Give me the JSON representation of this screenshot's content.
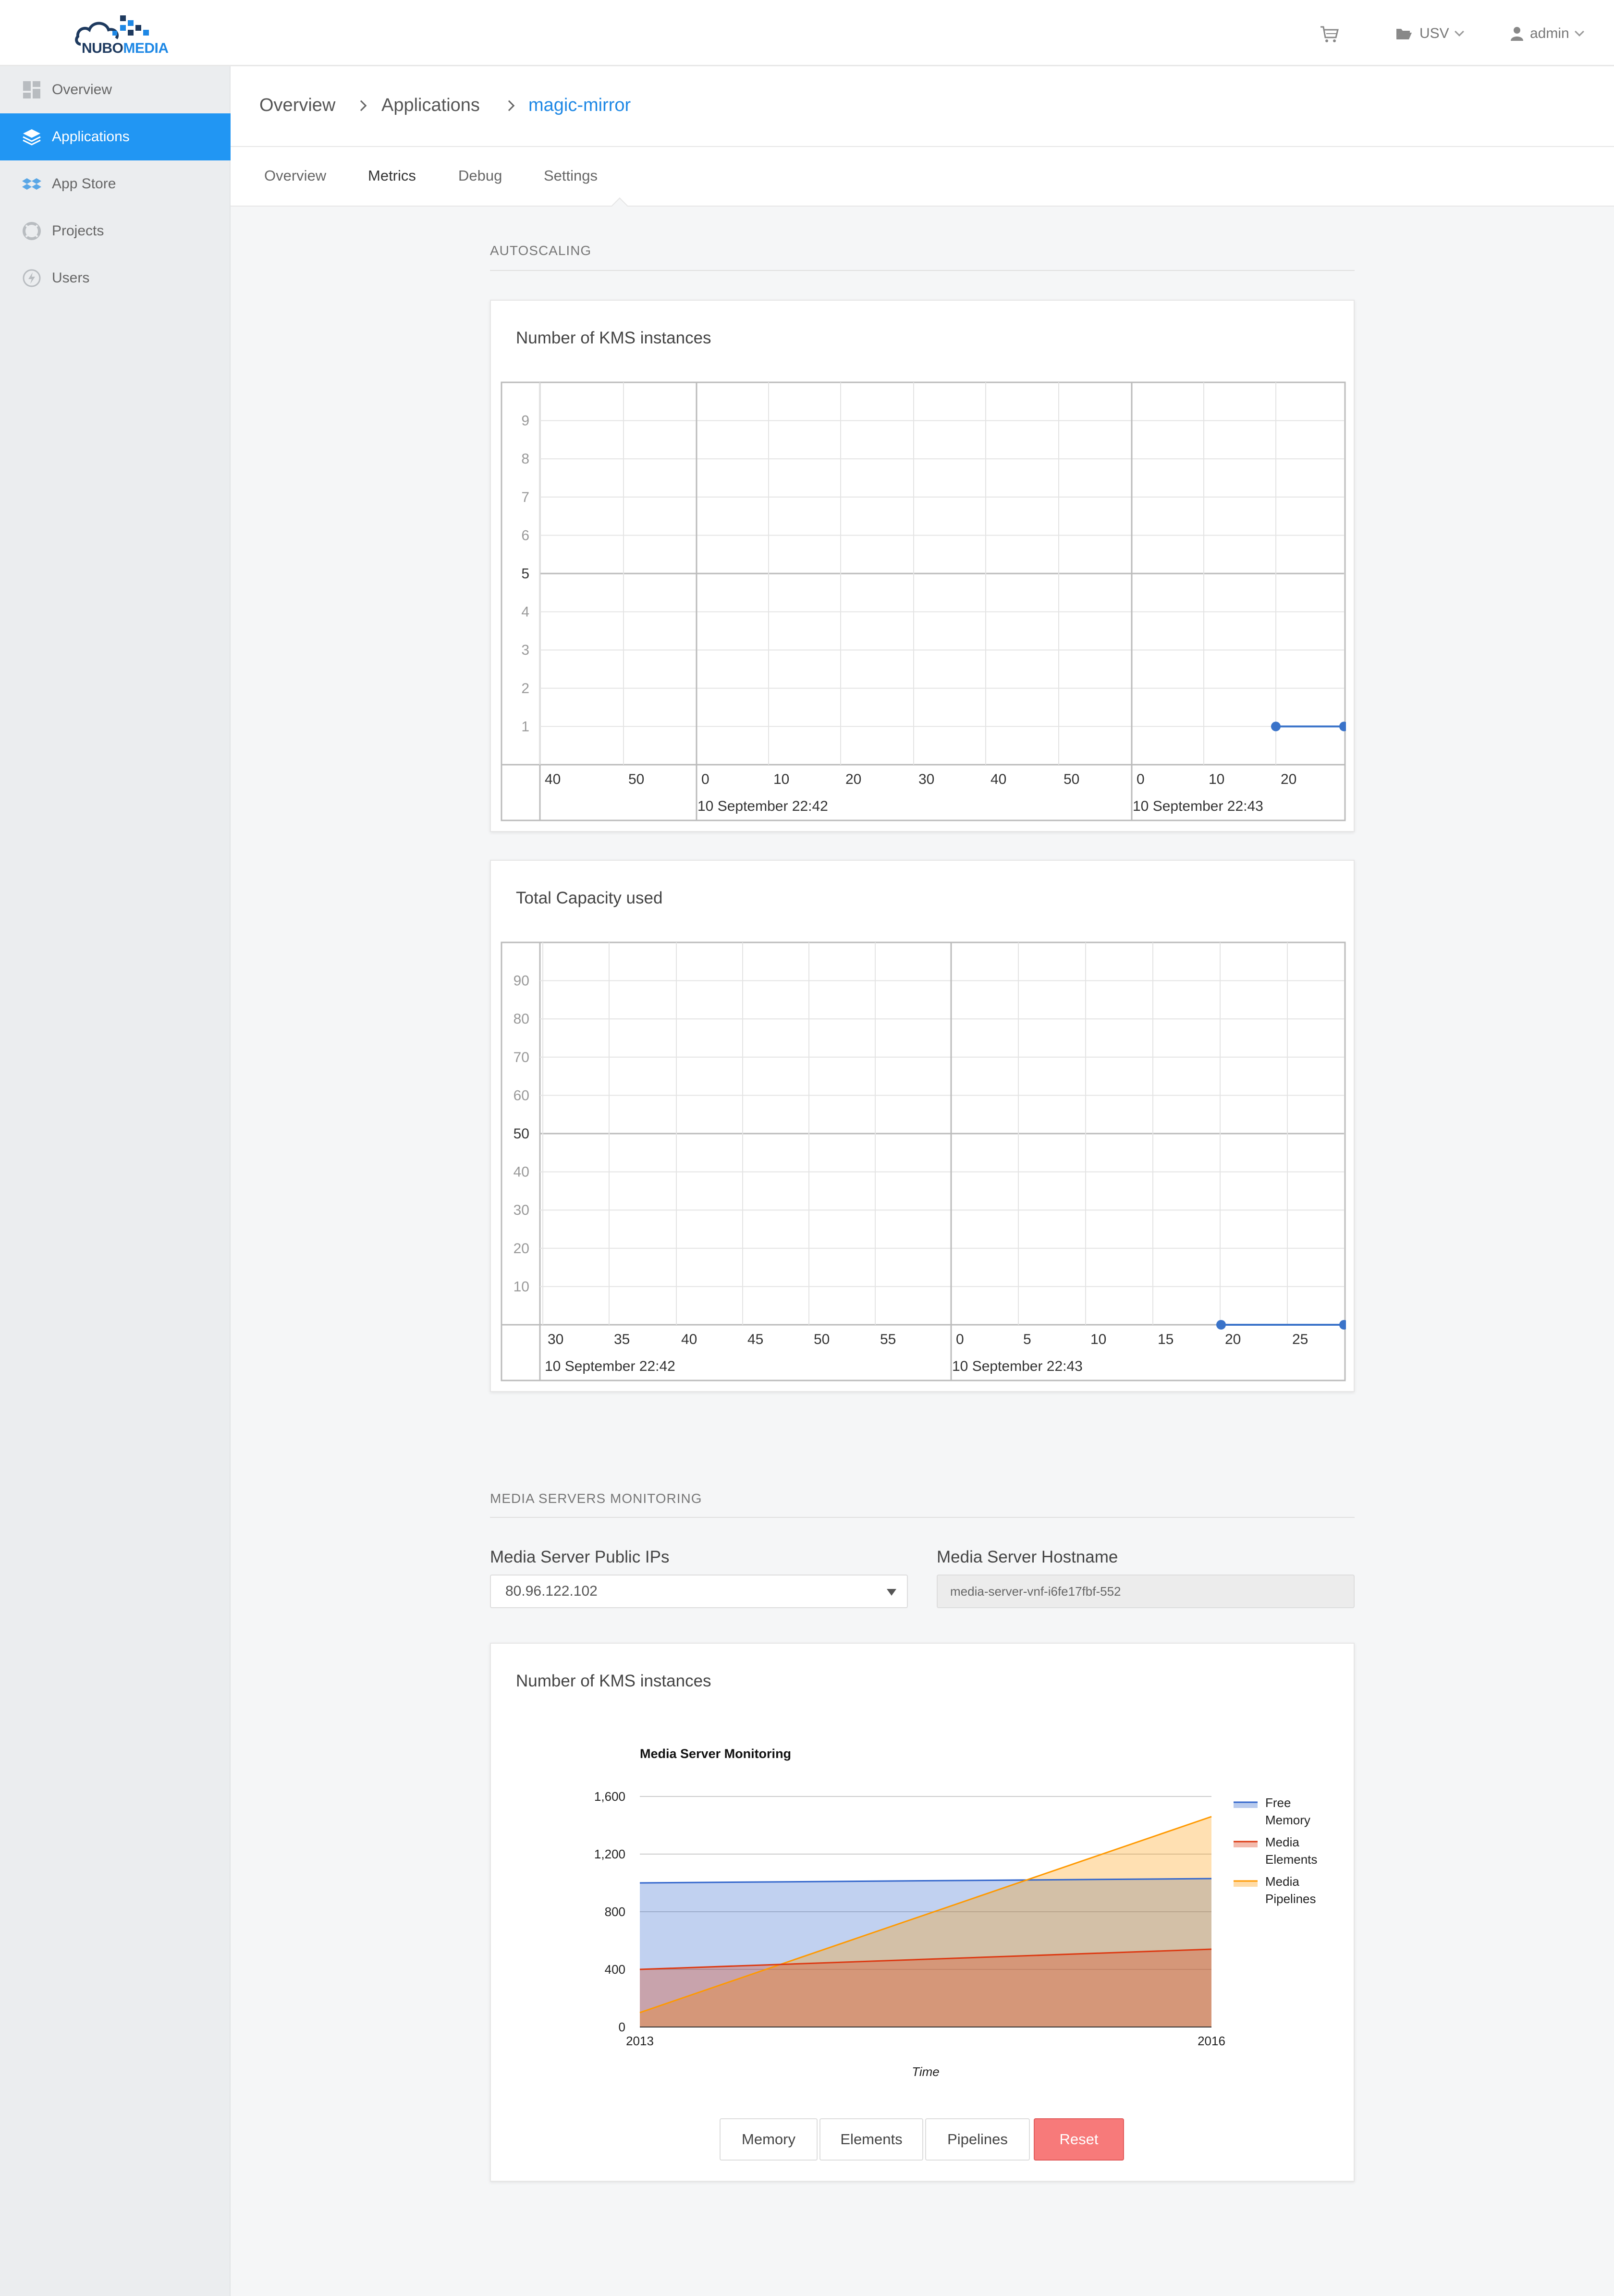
{
  "header": {
    "logo_text_a": "NUBO",
    "logo_text_b": "MEDIA",
    "project_label": "USV",
    "user_label": "admin"
  },
  "sidebar": {
    "items": [
      {
        "label": "Overview",
        "icon": "dashboard-icon"
      },
      {
        "label": "Applications",
        "icon": "layers-icon"
      },
      {
        "label": "App Store",
        "icon": "dropbox-icon"
      },
      {
        "label": "Projects",
        "icon": "lifebuoy-icon"
      },
      {
        "label": "Users",
        "icon": "bolt-icon"
      }
    ],
    "active_index": 1
  },
  "breadcrumb": {
    "items": [
      "Overview",
      "Applications",
      "magic-mirror"
    ]
  },
  "tabs": {
    "items": [
      "Overview",
      "Metrics",
      "Debug",
      "Settings"
    ],
    "active_index": 1
  },
  "autoscaling": {
    "section_title": "AUTOSCALING",
    "kms_chart": {
      "title": "Number of KMS instances",
      "y_ticks": [
        "1",
        "2",
        "3",
        "4",
        "5",
        "6",
        "7",
        "8",
        "9"
      ],
      "x_ticks": [
        "40",
        "50",
        "0",
        "10",
        "20",
        "30",
        "40",
        "50",
        "0",
        "10",
        "20"
      ],
      "x_groups": [
        "10 September 22:42",
        "10 September 22:43"
      ]
    },
    "capacity_chart": {
      "title": "Total Capacity used",
      "y_ticks": [
        "10",
        "20",
        "30",
        "40",
        "50",
        "60",
        "70",
        "80",
        "90"
      ],
      "x_ticks": [
        "30",
        "35",
        "40",
        "45",
        "50",
        "55",
        "0",
        "5",
        "10",
        "15",
        "20",
        "25"
      ],
      "x_groups": [
        "10 September 22:42",
        "10 September 22:43"
      ]
    }
  },
  "monitoring": {
    "section_title": "MEDIA SERVERS MONITORING",
    "ip_label": "Media Server Public IPs",
    "ip_value": "80.96.122.102",
    "hostname_label": "Media Server Hostname",
    "hostname_value": "media-server-vnf-i6fe17fbf-552",
    "card_title": "Number of KMS instances",
    "buttons": {
      "memory": "Memory",
      "elements": "Elements",
      "pipelines": "Pipelines",
      "reset": "Reset"
    }
  },
  "chart_data": [
    {
      "type": "line",
      "title": "Number of KMS instances",
      "x_groups": [
        "10 September 22:42",
        "10 September 22:43"
      ],
      "series": [
        {
          "values": [
            {
              "x": "22:43:19",
              "y": 1
            },
            {
              "x": "22:43:28",
              "y": 1
            }
          ]
        }
      ],
      "ylim": [
        0,
        10
      ],
      "grid": true
    },
    {
      "type": "line",
      "title": "Total Capacity used",
      "x_groups": [
        "10 September 22:42",
        "10 September 22:43"
      ],
      "series": [
        {
          "values": [
            {
              "x": "22:43:19",
              "y": 0
            },
            {
              "x": "22:43:28",
              "y": 0
            }
          ]
        }
      ],
      "ylim": [
        0,
        100
      ],
      "grid": true
    },
    {
      "type": "area",
      "title": "Media Server Monitoring",
      "xlabel": "Time",
      "ylabel": "",
      "x": [
        "2013",
        "2016"
      ],
      "ylim": [
        0,
        1600
      ],
      "y_ticks": [
        "0",
        "400",
        "800",
        "1,200",
        "1,600"
      ],
      "legend_position": "right",
      "series": [
        {
          "name": "Free Memory",
          "color": "#3366cc",
          "values": [
            1000,
            1030
          ]
        },
        {
          "name": "Media Elements",
          "color": "#dc3912",
          "values": [
            400,
            540
          ]
        },
        {
          "name": "Media Pipelines",
          "color": "#ff9900",
          "values": [
            100,
            1460
          ]
        }
      ]
    }
  ]
}
